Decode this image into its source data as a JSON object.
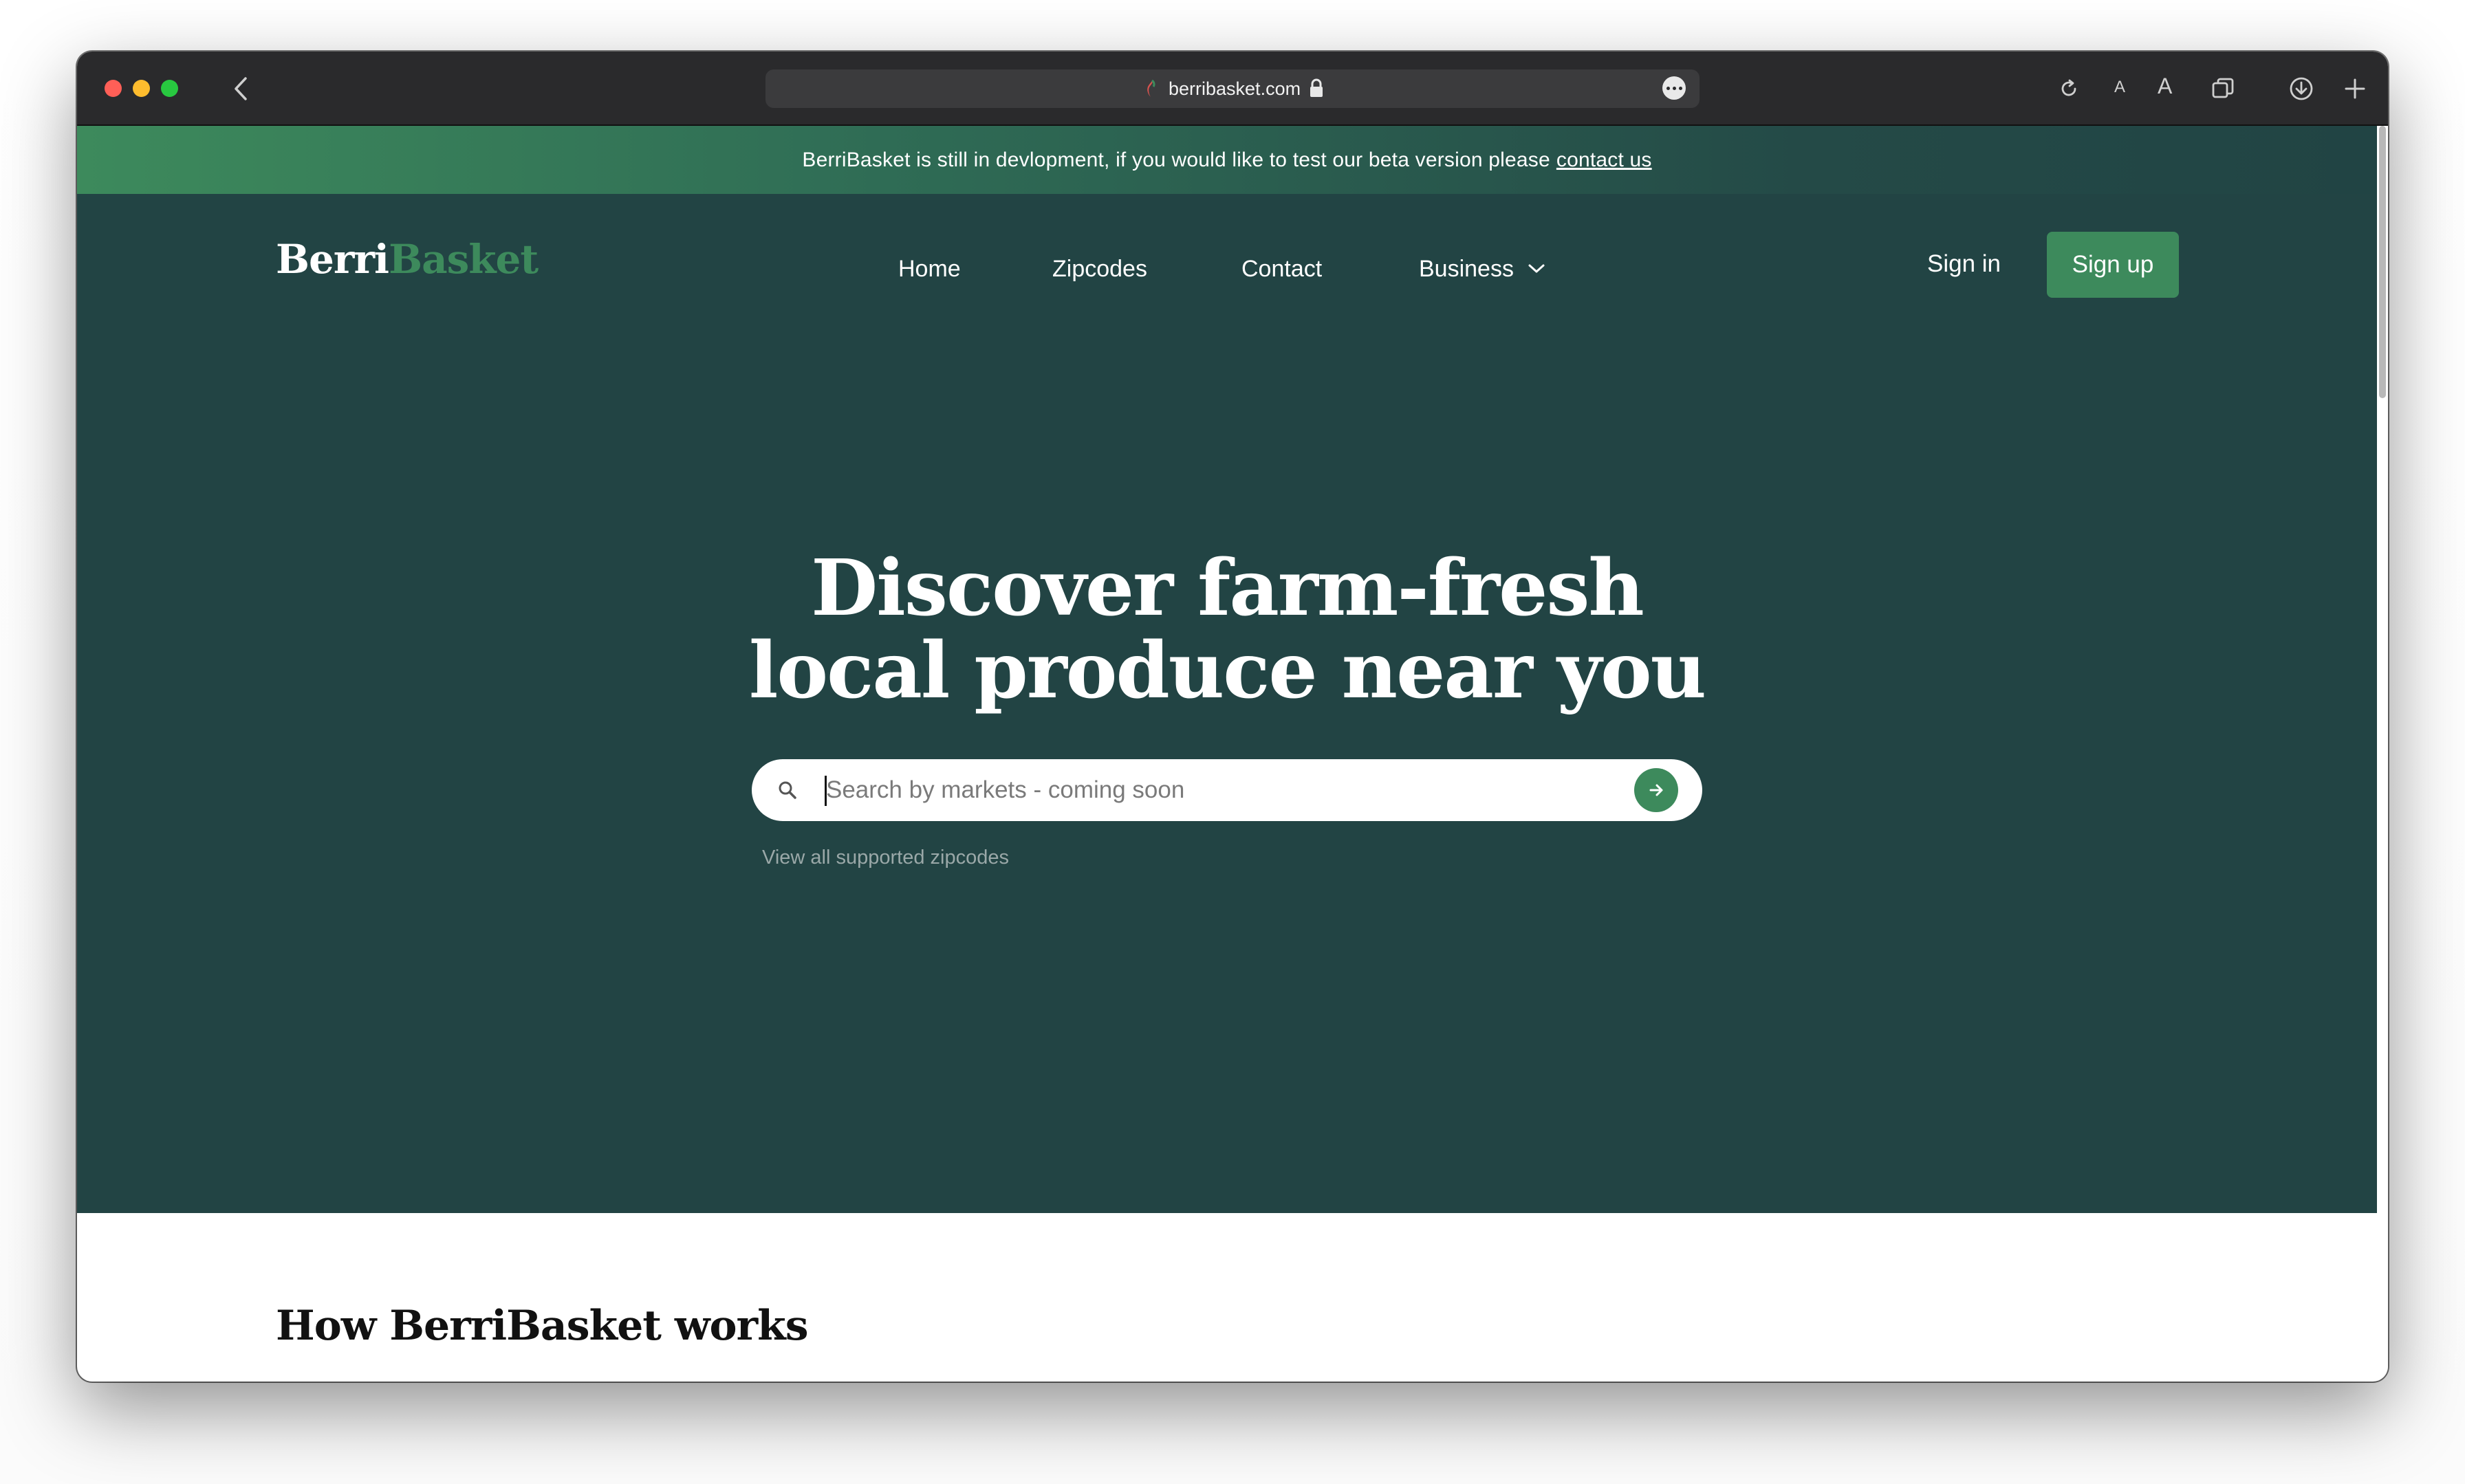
{
  "browser": {
    "url": "berribasket.com",
    "text_size_small_label": "A",
    "text_size_large_label": "A"
  },
  "banner": {
    "text": "BerriBasket is still in devlopment, if you would like to test our beta version please",
    "link_label": "contact us"
  },
  "header": {
    "logo_part1": "Berri",
    "logo_part2": "Basket",
    "nav": {
      "home": "Home",
      "zipcodes": "Zipcodes",
      "contact": "Contact",
      "business": "Business"
    },
    "sign_in": "Sign in",
    "sign_up": "Sign up"
  },
  "hero": {
    "headline_line1": "Discover farm-fresh",
    "headline_line2": "local produce near you",
    "search_placeholder": "Search by markets - coming soon",
    "zipcodes_link": "View all supported zipcodes"
  },
  "section": {
    "title": "How BerriBasket works"
  },
  "colors": {
    "hero_background": "#224444",
    "brand_green": "#3d8a5c",
    "chrome_background": "#2a2a2c"
  },
  "icons": [
    "back-icon",
    "lock-icon",
    "more-icon",
    "reload-icon",
    "tabs-icon",
    "download-icon",
    "new-tab-icon",
    "search-icon",
    "arrow-right-icon",
    "chevron-down-icon"
  ]
}
